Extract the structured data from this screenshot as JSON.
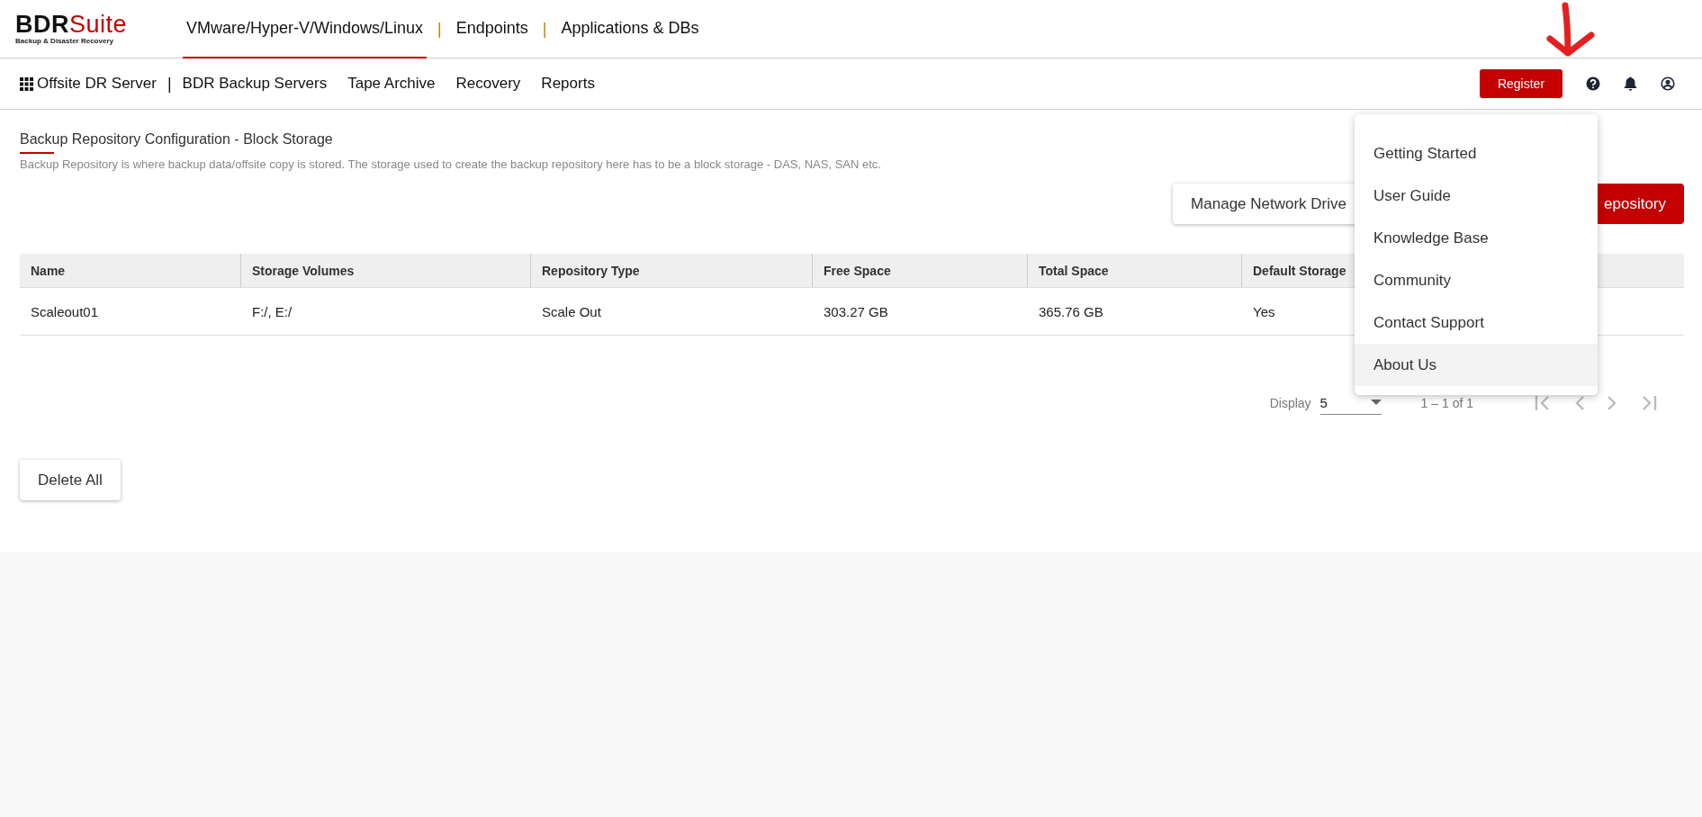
{
  "logo": {
    "brand_a": "BDR",
    "brand_b": "Suite",
    "tagline": "Backup & Disaster Recovery"
  },
  "top_tabs": [
    {
      "kind": "tab",
      "label": "VMware/Hyper-V/Windows/Linux",
      "selected": true
    },
    {
      "kind": "separator",
      "label": "|"
    },
    {
      "kind": "tab",
      "label": "Endpoints",
      "selected": false
    },
    {
      "kind": "separator",
      "label": "|"
    },
    {
      "kind": "tab",
      "label": "Applications & DBs",
      "selected": false
    }
  ],
  "sub_nav": {
    "server": "Offsite DR Server",
    "separator": "|",
    "items": [
      "BDR Backup Servers",
      "Tape Archive",
      "Recovery",
      "Reports"
    ]
  },
  "register_button": "Register",
  "page": {
    "title": "Backup Repository Configuration - Block Storage",
    "description": "Backup Repository is where backup data/offsite copy is stored. The storage used to create the backup repository here has to be a block storage - DAS, NAS, SAN etc."
  },
  "actions": {
    "manage_button": "Manage Network Drive",
    "add_button": "epository"
  },
  "table": {
    "columns": [
      "Name",
      "Storage Volumes",
      "Repository Type",
      "Free Space",
      "Total Space",
      "Default Storage"
    ],
    "rows": [
      [
        "Scaleout01",
        "F:/, E:/",
        "Scale Out",
        "303.27 GB",
        "365.76 GB",
        "Yes"
      ]
    ]
  },
  "pagination": {
    "label": "Display",
    "page_size": "5",
    "range": "1 – 1 of 1"
  },
  "delete_all_button": "Delete All",
  "help_menu": [
    {
      "label": "Getting Started",
      "selected": false
    },
    {
      "label": "User Guide",
      "selected": false
    },
    {
      "label": "Knowledge Base",
      "selected": false
    },
    {
      "label": "Community",
      "selected": false
    },
    {
      "label": "Contact Support",
      "selected": false
    },
    {
      "label": "About Us",
      "selected": true
    }
  ]
}
